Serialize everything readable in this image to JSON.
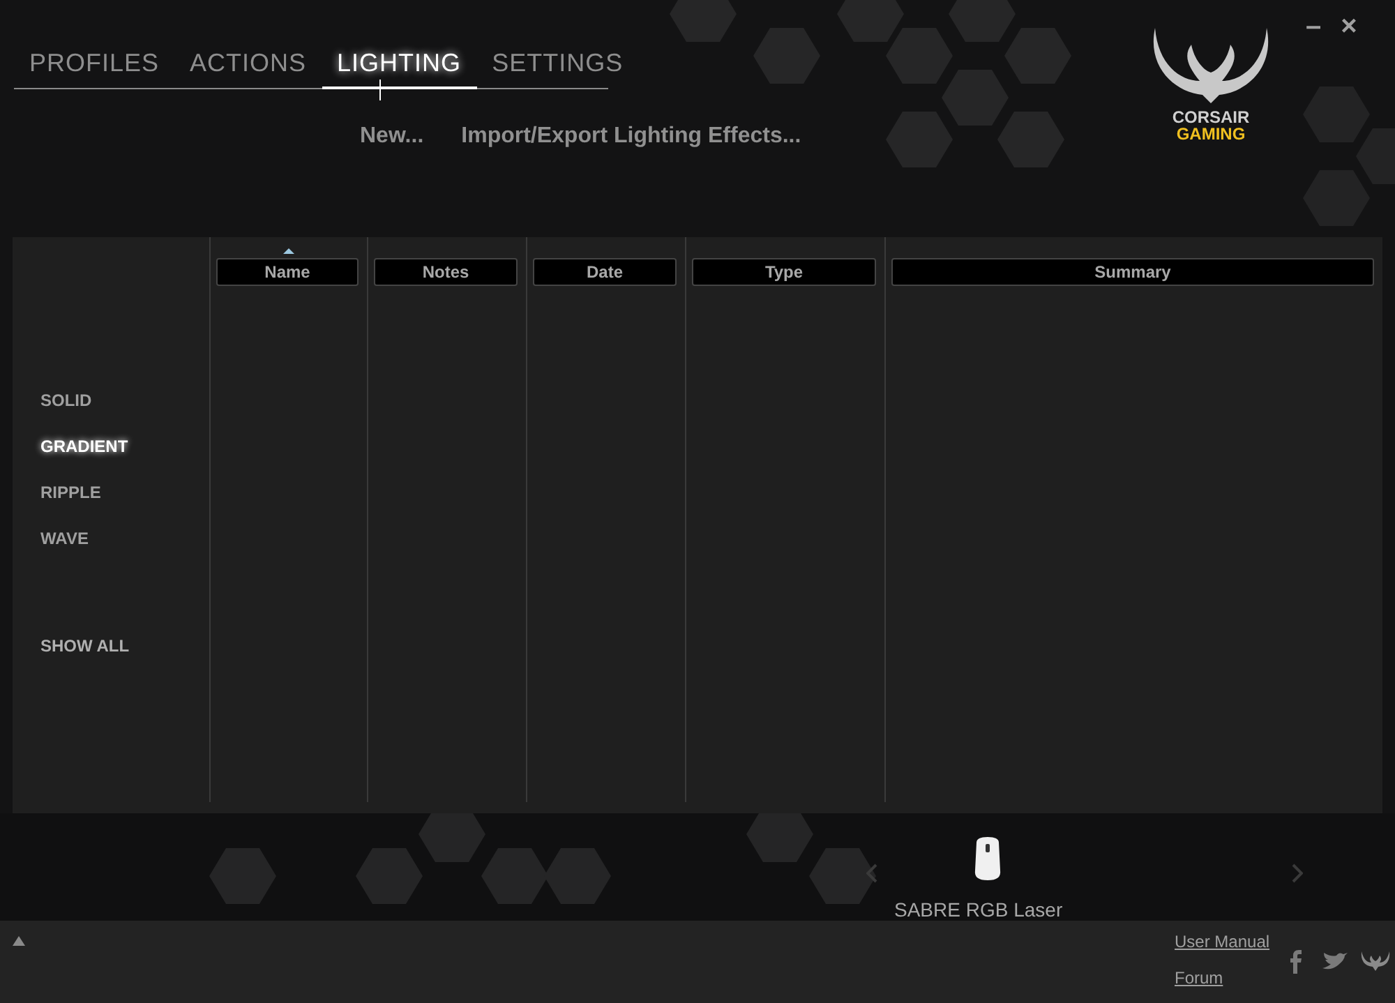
{
  "tabs": [
    {
      "label": "PROFILES",
      "selected": false
    },
    {
      "label": "ACTIONS",
      "selected": false
    },
    {
      "label": "LIGHTING",
      "selected": true
    },
    {
      "label": "SETTINGS",
      "selected": false
    }
  ],
  "toolbar_links": [
    "New...",
    "Import/Export Lighting Effects..."
  ],
  "logo": {
    "brand": "CORSAIR",
    "sub": "GAMING"
  },
  "window_controls": [
    "–",
    "×"
  ],
  "effect_filters": [
    {
      "label": "SOLID",
      "selected": false
    },
    {
      "label": "GRADIENT",
      "selected": true
    },
    {
      "label": "RIPPLE",
      "selected": false
    },
    {
      "label": "WAVE",
      "selected": false
    }
  ],
  "show_all": "SHOW ALL",
  "table": {
    "columns": [
      {
        "label": "Name",
        "sorted": true
      },
      {
        "label": "Notes",
        "sorted": false
      },
      {
        "label": "Date",
        "sorted": false
      },
      {
        "label": "Type",
        "sorted": false
      },
      {
        "label": "Summary",
        "sorted": false
      }
    ]
  },
  "device": {
    "name": "SABRE RGB Laser"
  },
  "footer_links": [
    "User Manual",
    "Forum"
  ]
}
